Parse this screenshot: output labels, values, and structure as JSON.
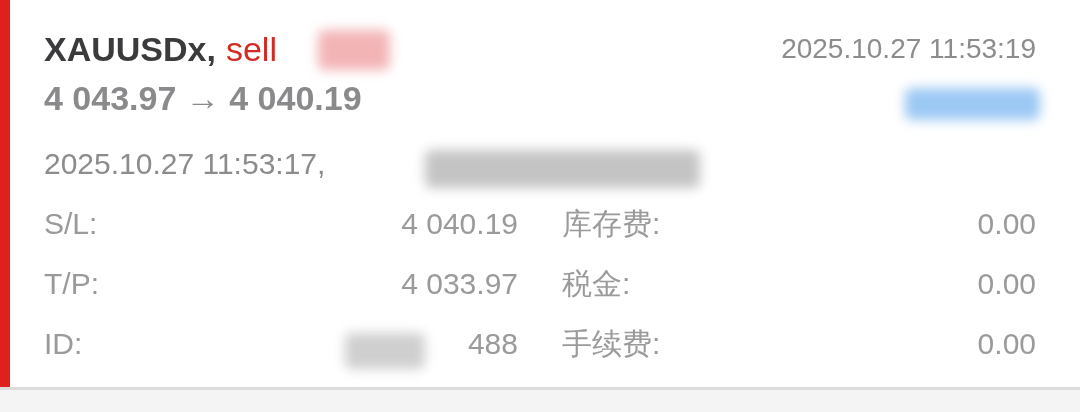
{
  "trade": {
    "symbol": "XAUUSDx,",
    "side": "sell",
    "close_time": "2025.10.27 11:53:19",
    "prices": "4 043.97 → 4 040.19",
    "open_time": "2025.10.27 11:53:17,",
    "details": [
      {
        "label": "S/L:",
        "value": "4 040.19",
        "fee_label": "库存费:",
        "fee_value": "0.00"
      },
      {
        "label": "T/P:",
        "value": "4 033.97",
        "fee_label": "税金:",
        "fee_value": "0.00"
      },
      {
        "label": "ID:",
        "value": "488",
        "fee_label": "手续费:",
        "fee_value": "0.00"
      }
    ]
  }
}
